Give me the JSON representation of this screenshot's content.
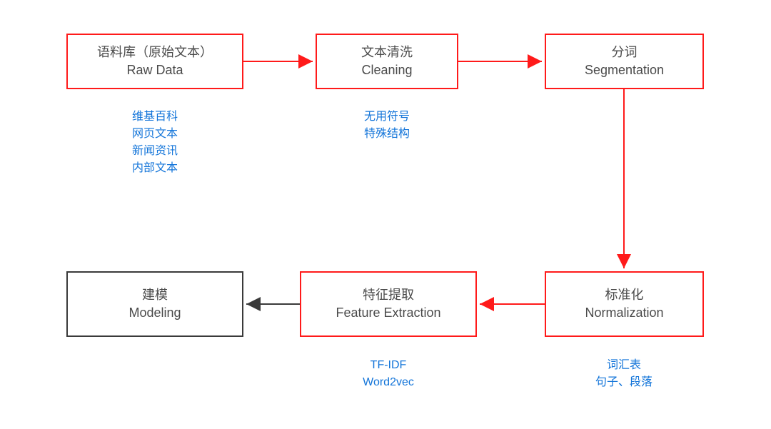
{
  "colors": {
    "red": "#ff1a1a",
    "black": "#3a3a3a",
    "note": "#1274d9"
  },
  "nodes": {
    "rawdata": {
      "title_cn": "语料库（原始文本）",
      "title_en": "Raw Data"
    },
    "cleaning": {
      "title_cn": "文本清洗",
      "title_en": "Cleaning"
    },
    "segmentation": {
      "title_cn": "分词",
      "title_en": "Segmentation"
    },
    "normalization": {
      "title_cn": "标准化",
      "title_en": "Normalization"
    },
    "feature": {
      "title_cn": "特征提取",
      "title_en": "Feature Extraction"
    },
    "modeling": {
      "title_cn": "建模",
      "title_en": "Modeling"
    }
  },
  "notes": {
    "rawdata": [
      "维基百科",
      "网页文本",
      "新闻资讯",
      "内部文本"
    ],
    "cleaning": [
      "无用符号",
      "特殊结构"
    ],
    "feature": [
      "TF-IDF",
      "Word2vec"
    ],
    "normalization": [
      "词汇表",
      "句子、段落"
    ]
  },
  "flow": [
    "rawdata",
    "cleaning",
    "segmentation",
    "normalization",
    "feature",
    "modeling"
  ],
  "arrows": [
    {
      "from": "rawdata",
      "to": "cleaning",
      "color": "red"
    },
    {
      "from": "cleaning",
      "to": "segmentation",
      "color": "red"
    },
    {
      "from": "segmentation",
      "to": "normalization",
      "color": "red"
    },
    {
      "from": "normalization",
      "to": "feature",
      "color": "red"
    },
    {
      "from": "feature",
      "to": "modeling",
      "color": "black"
    }
  ]
}
